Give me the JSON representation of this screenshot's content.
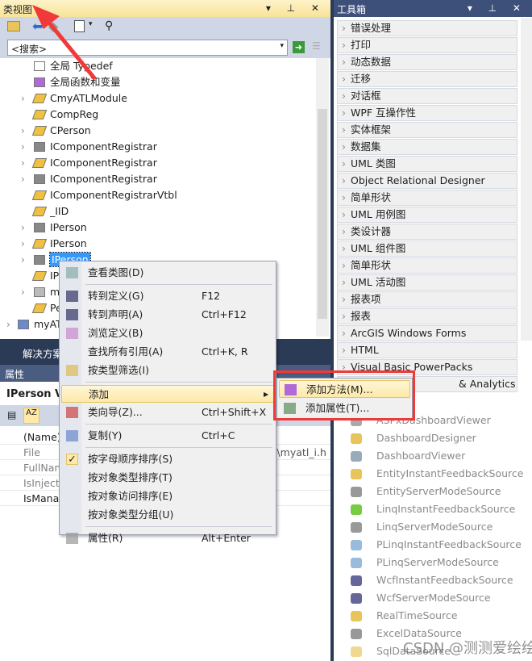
{
  "class_view": {
    "title": "类视图",
    "search_placeholder": "<搜索>",
    "tree": [
      {
        "label": "全局 Typedef",
        "expandable": false,
        "icon": "typedef-icon"
      },
      {
        "label": "全局函数和变量",
        "expandable": false,
        "icon": "global-functions-icon"
      },
      {
        "label": "CmyATLModule",
        "expandable": true,
        "icon": "class-icon"
      },
      {
        "label": "CompReg",
        "expandable": false,
        "icon": "class-icon"
      },
      {
        "label": "CPerson",
        "expandable": true,
        "icon": "class-icon"
      },
      {
        "label": "IComponentRegistrar",
        "expandable": true,
        "icon": "interface-icon"
      },
      {
        "label": "IComponentRegistrar",
        "expandable": true,
        "icon": "class-icon"
      },
      {
        "label": "IComponentRegistrar",
        "expandable": true,
        "icon": "interface-icon"
      },
      {
        "label": "IComponentRegistrarVtbl",
        "expandable": false,
        "icon": "class-icon"
      },
      {
        "label": "_IID",
        "expandable": false,
        "icon": "class-icon"
      },
      {
        "label": "IPerson",
        "expandable": true,
        "icon": "interface-icon"
      },
      {
        "label": "IPerson",
        "expandable": true,
        "icon": "class-icon"
      },
      {
        "label": "IPerson",
        "expandable": true,
        "icon": "interface-icon",
        "selected": true
      },
      {
        "label": "IP",
        "expandable": false,
        "icon": "class-icon"
      },
      {
        "label": "m",
        "expandable": true,
        "icon": "module-icon"
      },
      {
        "label": "Pe",
        "expandable": false,
        "icon": "class-icon"
      },
      {
        "label": "myAT",
        "expandable": true,
        "icon": "project-icon",
        "root": true
      }
    ]
  },
  "solution_tab": "解决方案",
  "properties": {
    "title": "属性",
    "header": "IPerson VC",
    "rows": [
      {
        "name": "(Name)",
        "bold": true
      },
      {
        "name": "File",
        "value": "l\\myatl_i.h"
      },
      {
        "name": "FullNam"
      },
      {
        "name": "IsInjecte"
      },
      {
        "name": "IsMana",
        "bold": true
      }
    ]
  },
  "toolbox": {
    "title": "工具箱",
    "categories": [
      "错误处理",
      "打印",
      "动态数据",
      "迁移",
      "对话框",
      "WPF 互操作性",
      "实体框架",
      "数据集",
      "UML 类图",
      "Object Relational Designer",
      "简单形状",
      "UML 用例图",
      "类设计器",
      "UML 组件图",
      "简单形状",
      "UML 活动图",
      "报表项",
      "报表",
      "ArcGIS Windows Forms",
      "HTML",
      "Visual Basic PowerPacks",
      "& Analytics"
    ],
    "items": [
      "ASPxDashboardViewer",
      "DashboardDesigner",
      "DashboardViewer",
      "EntityInstantFeedbackSource",
      "EntityServerModeSource",
      "LinqInstantFeedbackSource",
      "LinqServerModeSource",
      "PLinqInstantFeedbackSource",
      "PLinqServerModeSource",
      "WcfInstantFeedbackSource",
      "WcfServerModeSource",
      "RealTimeSource",
      "ExcelDataSource",
      "SqlDataSource"
    ]
  },
  "context_menu": [
    {
      "label": "查看类图(D)",
      "icon": "class-diagram-icon"
    },
    {
      "sep": true
    },
    {
      "label": "转到定义(G)",
      "shortcut": "F12",
      "icon": "goto-definition-icon"
    },
    {
      "label": "转到声明(A)",
      "shortcut": "Ctrl+F12",
      "icon": "goto-declaration-icon"
    },
    {
      "label": "浏览定义(B)",
      "icon": "browse-definition-icon"
    },
    {
      "label": "查找所有引用(A)",
      "shortcut": "Ctrl+K, R"
    },
    {
      "label": "按类型筛选(I)",
      "icon": "filter-icon"
    },
    {
      "sep": true
    },
    {
      "label": "添加",
      "submenu": true,
      "highlighted": true
    },
    {
      "label": "类向导(Z)...",
      "shortcut": "Ctrl+Shift+X",
      "icon": "class-wizard-icon"
    },
    {
      "sep": true
    },
    {
      "label": "复制(Y)",
      "shortcut": "Ctrl+C",
      "icon": "copy-icon"
    },
    {
      "sep": true
    },
    {
      "label": "按字母顺序排序(S)",
      "checked": true
    },
    {
      "label": "按对象类型排序(T)"
    },
    {
      "label": "按对象访问排序(E)"
    },
    {
      "label": "按对象类型分组(U)"
    },
    {
      "sep": true
    },
    {
      "label": "属性(R)",
      "shortcut": "Alt+Enter",
      "icon": "properties-icon"
    }
  ],
  "submenu": [
    {
      "label": "添加方法(M)...",
      "icon": "add-method-icon",
      "highlighted": true
    },
    {
      "label": "添加属性(T)...",
      "icon": "add-property-icon"
    }
  ],
  "watermark": "CSDN @测测爱绘绘",
  "colors": {
    "annotation_red": "#f03a3a",
    "title_active": "#f8e39a",
    "frame": "#2b3a55"
  }
}
